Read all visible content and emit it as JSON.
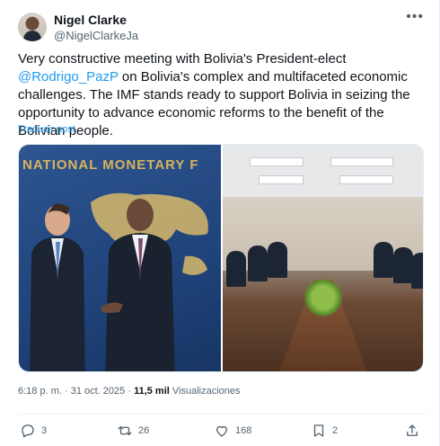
{
  "author": {
    "name": "Nigel Clarke",
    "handle": "@NigelClarkeJa"
  },
  "post": {
    "text_before": "Very constructive meeting with Bolivia's President-elect ",
    "mention": "@Rodrigo_PazP",
    "text_after": " on Bolivia's complex and multifaceted economic challenges. The IMF stands ready to support Bolivia in seizing the opportunity to advance economic reforms to the benefit of the Bolivian people.",
    "translate_label": "Traducir post"
  },
  "media": {
    "banner_text": "NATIONAL MONETARY F"
  },
  "meta": {
    "time": "6:18 p. m.",
    "sep": "·",
    "date": "31 oct. 2025",
    "views_count": "11,5 mil",
    "views_label": "Visualizaciones"
  },
  "actions": {
    "replies": "3",
    "reposts": "26",
    "likes": "168",
    "bookmarks": "2"
  },
  "colors": {
    "link": "#1d9bf0",
    "text": "#0f1419",
    "muted": "#536471"
  },
  "icons": [
    "more-icon",
    "reply-icon",
    "repost-icon",
    "like-icon",
    "bookmark-icon",
    "share-icon"
  ]
}
